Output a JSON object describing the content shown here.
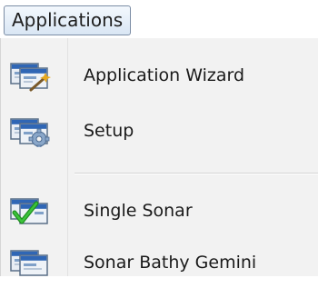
{
  "menubar": {
    "applications_label": "Applications"
  },
  "menu": {
    "items": [
      {
        "label": "Application Wizard",
        "icon": "application-wizard-icon"
      },
      {
        "label": "Setup",
        "icon": "setup-gear-icon"
      },
      {
        "label": "Single Sonar",
        "icon": "single-sonar-check-icon"
      },
      {
        "label": "Sonar Bathy Gemini",
        "icon": "sonar-bathy-window-icon"
      }
    ]
  },
  "colors": {
    "menu_background": "#f2f2f2",
    "window_icon_title": "#2f66b5",
    "checkmark": "#2aa52a",
    "wand": "#e6a81e",
    "gear": "#8aa7c9"
  }
}
